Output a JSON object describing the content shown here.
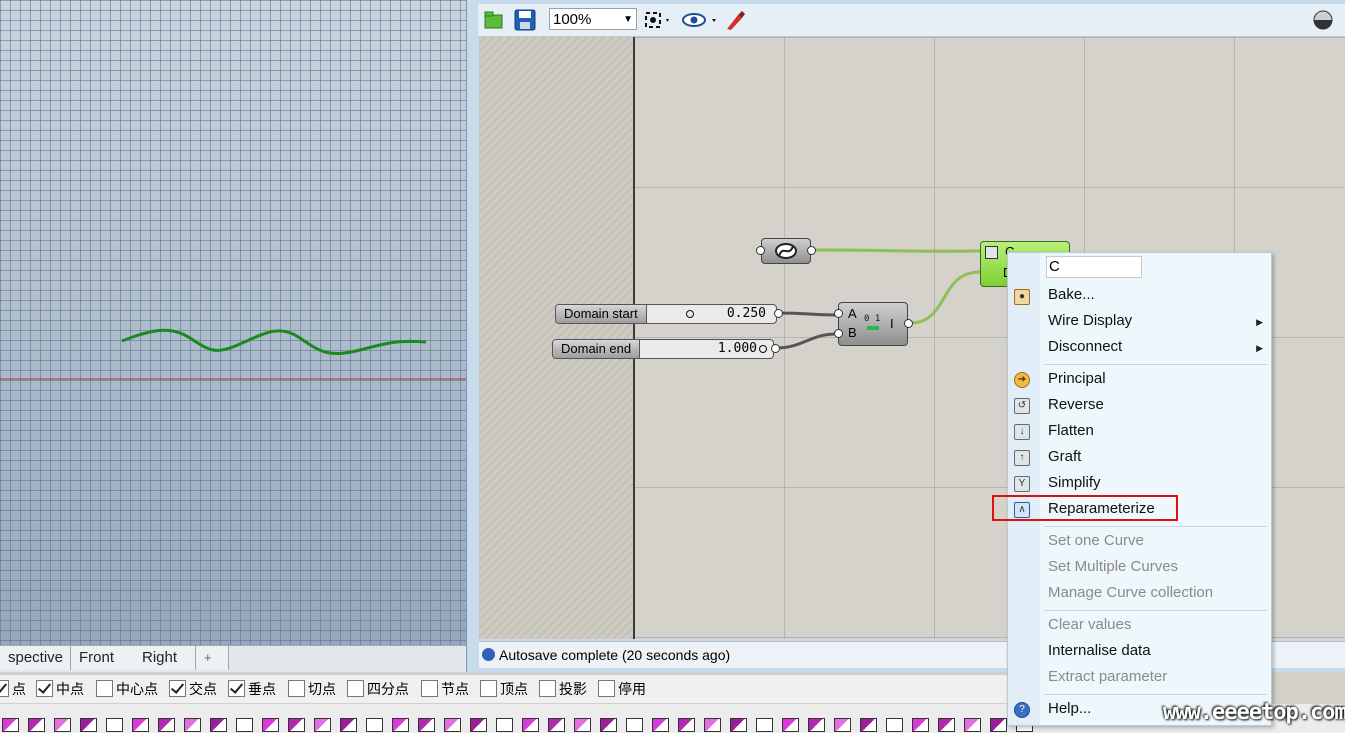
{
  "viewport": {
    "tabs": [
      "spective",
      "Front",
      "Right",
      "+"
    ],
    "curve_color": "#1a8a1a"
  },
  "osnap": [
    {
      "label": "点",
      "checked": true
    },
    {
      "label": "中点",
      "checked": true
    },
    {
      "label": "中心点",
      "checked": false
    },
    {
      "label": "交点",
      "checked": true
    },
    {
      "label": "垂点",
      "checked": true
    },
    {
      "label": "切点",
      "checked": false
    },
    {
      "label": "四分点",
      "checked": false
    },
    {
      "label": "节点",
      "checked": false
    },
    {
      "label": "顶点",
      "checked": false
    },
    {
      "label": "投影",
      "checked": false
    },
    {
      "label": "停用",
      "checked": false
    }
  ],
  "gh": {
    "zoom": "100%",
    "status": "Autosave complete (20 seconds ago)",
    "sliders": [
      {
        "label": "Domain start",
        "value": "0.250"
      },
      {
        "label": "Domain end",
        "value": "1.000"
      }
    ],
    "domain_component": {
      "input_a": "A",
      "input_b": "B",
      "output": "I"
    },
    "curve_param": {
      "input_c": "C",
      "input_d": "D",
      "color": "#8fdc3c"
    }
  },
  "menu": {
    "name_value": "C",
    "items": [
      {
        "label": "Bake...",
        "enabled": true,
        "submenu": false
      },
      {
        "label": "Wire Display",
        "enabled": true,
        "submenu": true
      },
      {
        "label": "Disconnect",
        "enabled": true,
        "submenu": true
      },
      {
        "label": "Principal",
        "enabled": true
      },
      {
        "label": "Reverse",
        "enabled": true
      },
      {
        "label": "Flatten",
        "enabled": true
      },
      {
        "label": "Graft",
        "enabled": true
      },
      {
        "label": "Simplify",
        "enabled": true
      },
      {
        "label": "Reparameterize",
        "enabled": true,
        "checked": true
      },
      {
        "label": "Set one Curve",
        "enabled": false
      },
      {
        "label": "Set Multiple Curves",
        "enabled": false
      },
      {
        "label": "Manage Curve collection",
        "enabled": false
      },
      {
        "label": "Clear values",
        "enabled": false
      },
      {
        "label": "Internalise data",
        "enabled": true
      },
      {
        "label": "Extract parameter",
        "enabled": false
      },
      {
        "label": "Help...",
        "enabled": true
      }
    ]
  },
  "watermark": "www.eeeetop.com"
}
